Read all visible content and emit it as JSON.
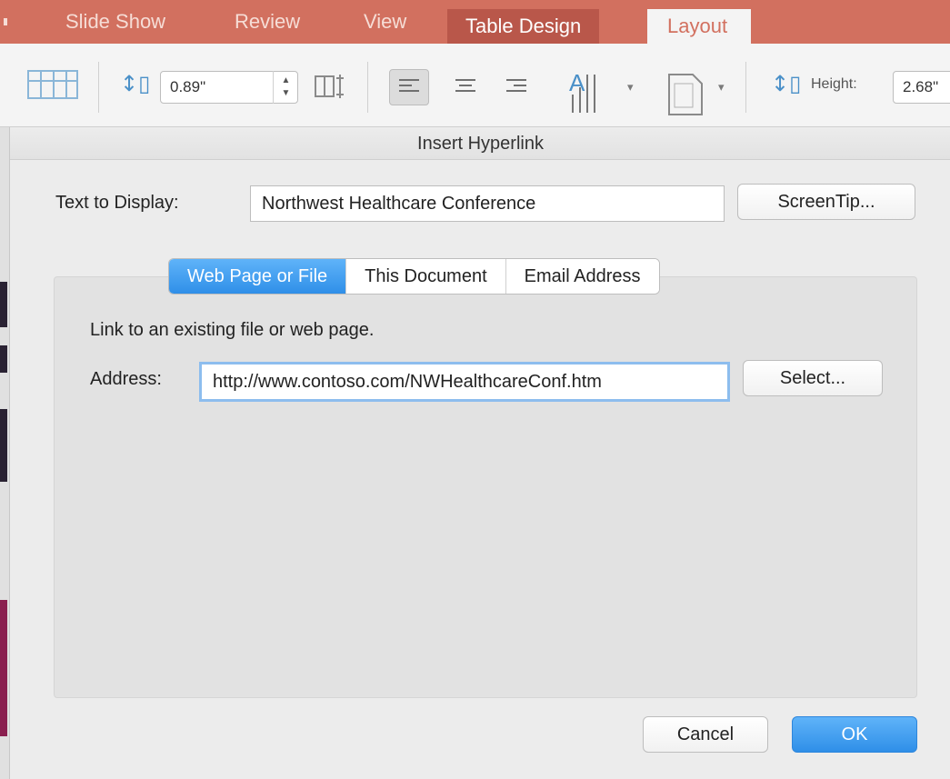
{
  "ribbon": {
    "tabs": [
      "Slide Show",
      "Review",
      "View",
      "Table Design",
      "Layout"
    ],
    "active_tab": "Layout",
    "row_height_value": "0.89\"",
    "height_label": "Height:",
    "height_value": "2.68\""
  },
  "dialog": {
    "title": "Insert Hyperlink",
    "text_to_display_label": "Text to Display:",
    "text_to_display_value": "Northwest Healthcare Conference",
    "screentip_label": "ScreenTip...",
    "tabs": [
      "Web Page or File",
      "This Document",
      "Email Address"
    ],
    "selected_tab": "Web Page or File",
    "panel_description": "Link to an existing file or web page.",
    "address_label": "Address:",
    "address_value": "http://www.contoso.com/NWHealthcareConf.htm",
    "select_label": "Select...",
    "cancel_label": "Cancel",
    "ok_label": "OK"
  },
  "colors": {
    "ribbon_accent": "#d2705f",
    "primary_button": "#2f8fe8"
  }
}
